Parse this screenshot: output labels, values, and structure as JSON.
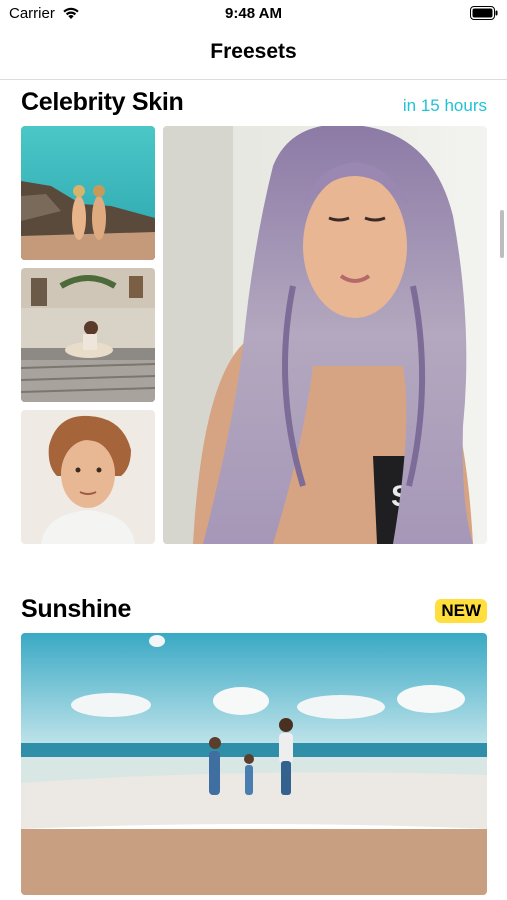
{
  "status_bar": {
    "carrier": "Carrier",
    "time": "9:48 AM",
    "wifi_icon": "wifi-icon",
    "battery_icon": "battery-icon"
  },
  "nav": {
    "title": "Freesets"
  },
  "sections": [
    {
      "title": "Celebrity Skin",
      "countdown": "in 15 hours",
      "countdown_color": "#21c3d6",
      "photos": [
        "beach-couple-photo",
        "bedroom-photo",
        "young-man-portrait",
        "lavender-hair-woman-photo"
      ]
    },
    {
      "title": "Sunshine",
      "badge": "NEW",
      "badge_color": "#ffde3d",
      "photos": [
        "beach-family-photo"
      ]
    }
  ]
}
